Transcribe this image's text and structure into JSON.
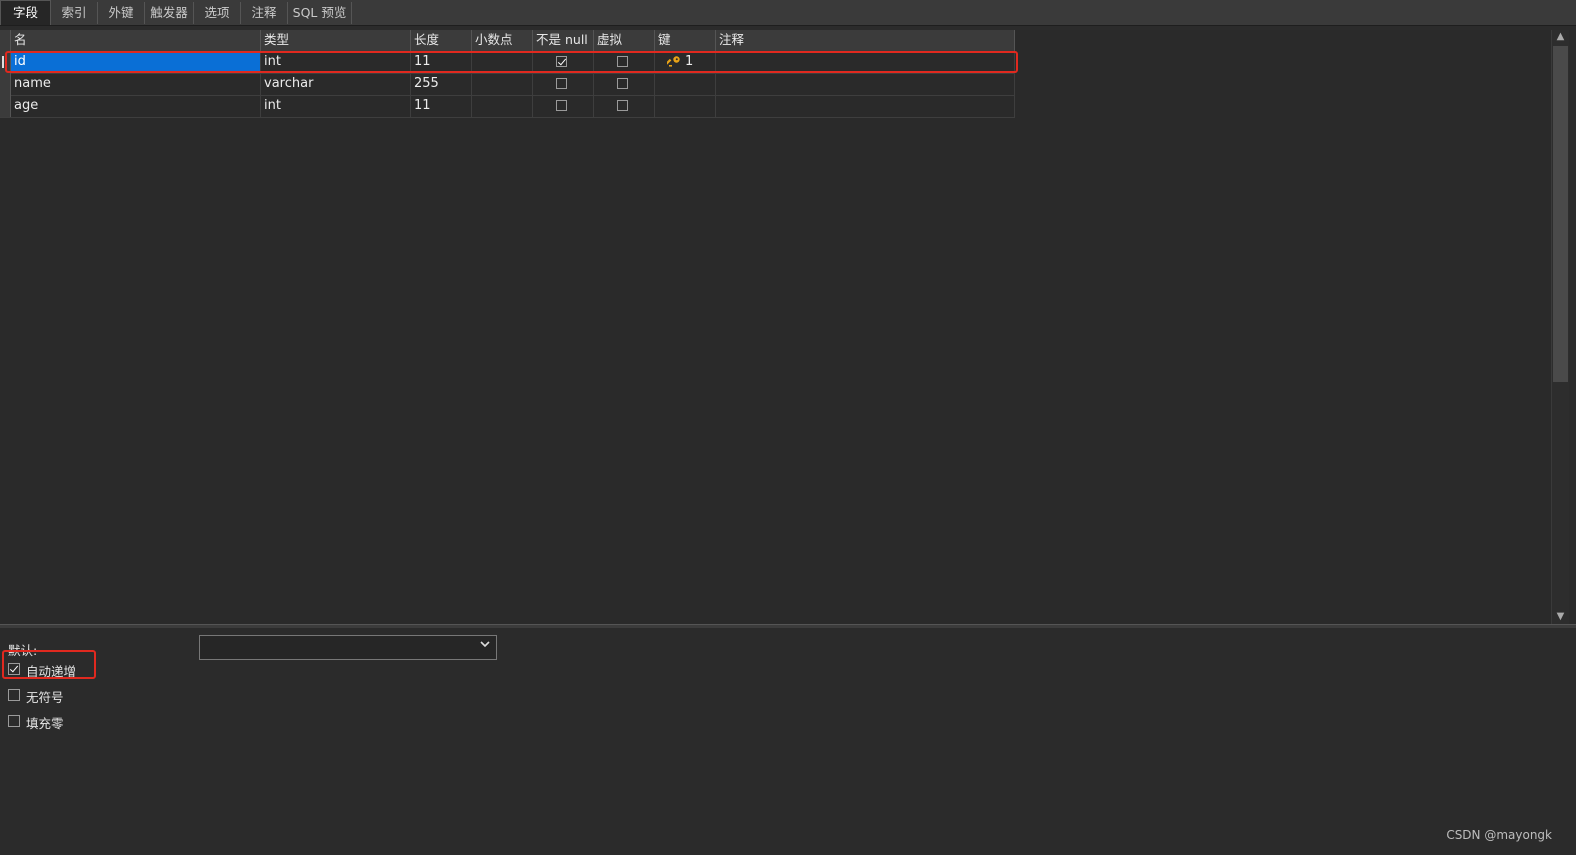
{
  "tabs": [
    "字段",
    "索引",
    "外键",
    "触发器",
    "选项",
    "注释",
    "SQL 预览"
  ],
  "columns": [
    "名",
    "类型",
    "长度",
    "小数点",
    "不是 null",
    "虚拟",
    "键",
    "注释"
  ],
  "rows": [
    {
      "name": "id",
      "type": "int",
      "length": "11",
      "decimals": "",
      "not_null": true,
      "virtual": false,
      "key": "1",
      "comment": ""
    },
    {
      "name": "name",
      "type": "varchar",
      "length": "255",
      "decimals": "",
      "not_null": false,
      "virtual": false,
      "key": "",
      "comment": ""
    },
    {
      "name": "age",
      "type": "int",
      "length": "11",
      "decimals": "",
      "not_null": false,
      "virtual": false,
      "key": "",
      "comment": ""
    }
  ],
  "props": {
    "default_label": "默认:",
    "default_value": "",
    "auto_increment_label": "自动递增",
    "auto_increment": true,
    "unsigned_label": "无符号",
    "unsigned": false,
    "zerofill_label": "填充零",
    "zerofill": false
  },
  "watermark": "CSDN @mayongk",
  "icons": {
    "key": "key-icon",
    "dropdown": "chevron-down-icon"
  },
  "colors": {
    "selection": "#0a6fd6",
    "highlight_box": "#e0291f",
    "key_icon": "#e8a317"
  }
}
